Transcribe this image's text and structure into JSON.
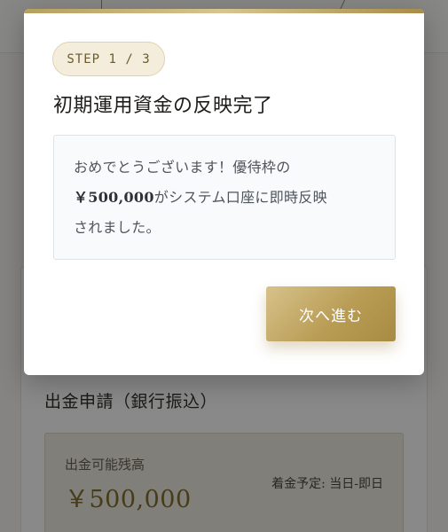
{
  "background": {
    "section_title": "出金申請（銀行振込）",
    "balance_label": "出金可能残高",
    "balance_value": "￥500,000",
    "schedule": "着金予定: 当日-即日"
  },
  "modal": {
    "step_badge": "STEP 1 / 3",
    "title": "初期運用資金の反映完了",
    "message_line1": "おめでとうございます！優待枠の",
    "message_amount": "￥500,000",
    "message_line2_suffix": "がシステム口座に即時反映",
    "message_line3": "されました。",
    "next_button": "次へ進む"
  },
  "colors": {
    "accent_gold": "#b99d55",
    "badge_bg": "#f4eddc",
    "title_text": "#1f1d19"
  }
}
